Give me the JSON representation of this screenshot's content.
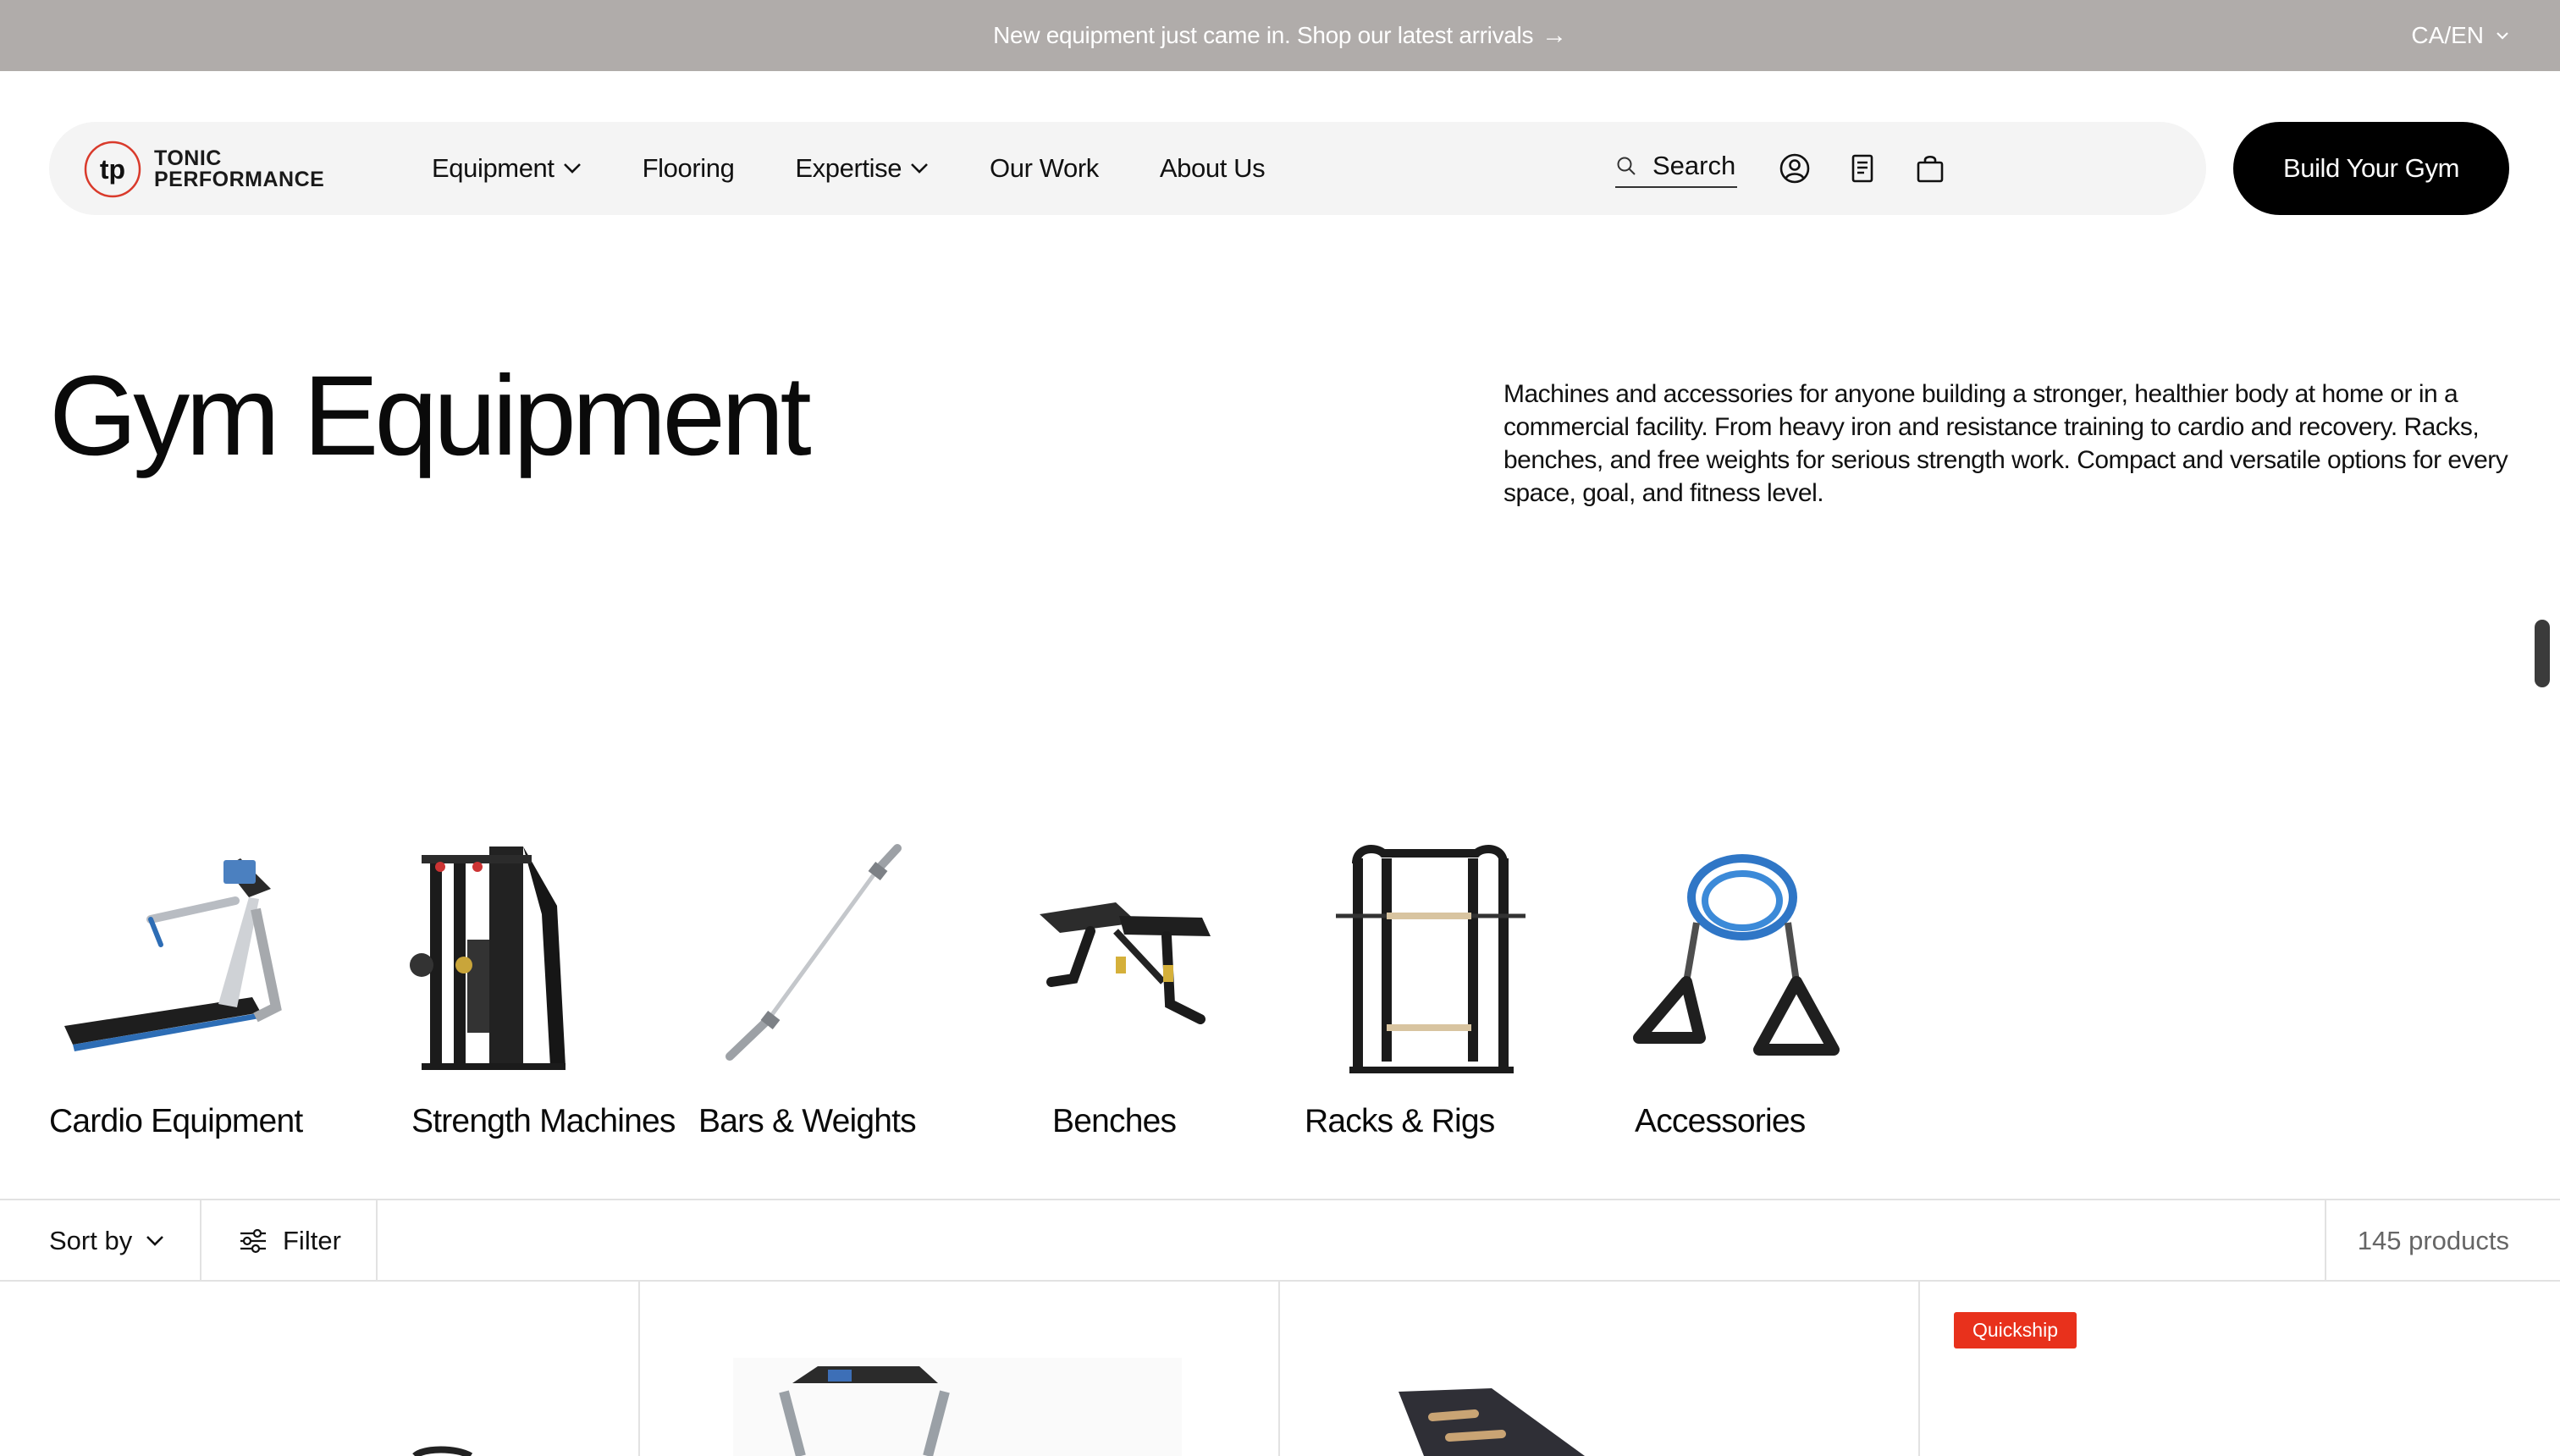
{
  "announcement": {
    "text": "New equipment just came in.  Shop our latest arrivals",
    "arrow": "→",
    "locale": "CA/EN"
  },
  "brand": {
    "mark": "tp",
    "line1": "TONIC",
    "line2": "PERFORMANCE",
    "accent": "#d93a2b"
  },
  "nav": {
    "items": [
      {
        "label": "Equipment",
        "dropdown": true
      },
      {
        "label": "Flooring",
        "dropdown": false
      },
      {
        "label": "Expertise",
        "dropdown": true
      },
      {
        "label": "Our Work",
        "dropdown": false
      },
      {
        "label": "About Us",
        "dropdown": false
      }
    ],
    "search_placeholder": "Search",
    "icons": [
      "search-icon",
      "account-icon",
      "quote-list-icon",
      "cart-icon"
    ],
    "cta": "Build Your Gym"
  },
  "hero": {
    "title": "Gym Equipment",
    "description": "Machines and accessories for anyone building a stronger, healthier body at home or in a commercial facility. From heavy iron and resistance training to cardio and recovery. Racks, benches, and free weights for serious strength work. Compact and versatile options for every space, goal, and fitness level."
  },
  "categories": [
    {
      "label": "Cardio Equipment",
      "icon": "treadmill-image"
    },
    {
      "label": "Strength Machines",
      "icon": "cable-machine-image"
    },
    {
      "label": "Bars & Weights",
      "icon": "barbell-image"
    },
    {
      "label": "Benches",
      "icon": "bench-image"
    },
    {
      "label": "Racks & Rigs",
      "icon": "power-rack-image"
    },
    {
      "label": "Accessories",
      "icon": "resistance-band-image"
    }
  ],
  "toolbar": {
    "sort_label": "Sort by",
    "filter_label": "Filter",
    "product_count": "145 products"
  },
  "products": [
    {
      "badge": ""
    },
    {
      "badge": ""
    },
    {
      "badge": ""
    },
    {
      "badge": "Quickship"
    }
  ],
  "colors": {
    "announcement_bg": "#b0acaa",
    "nav_bg": "#f4f4f4",
    "cta_bg": "#000000",
    "badge_bg": "#e8311c"
  }
}
